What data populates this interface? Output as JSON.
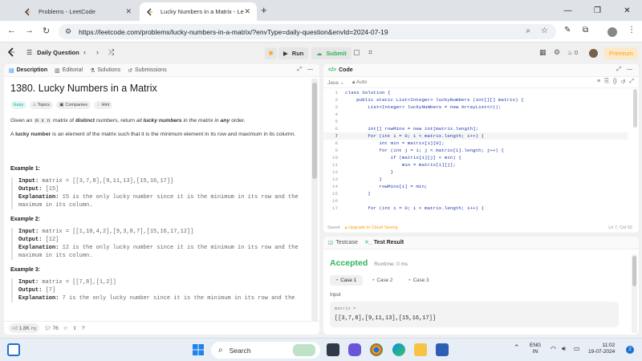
{
  "browser": {
    "tabs": [
      {
        "title": "Problems - LeetCode"
      },
      {
        "title": "Lucky Numbers in a Matrix - Le"
      }
    ],
    "new_tab": "+",
    "url": "https://leetcode.com/problems/lucky-numbers-in-a-matrix/?envType=daily-question&envId=2024-07-19"
  },
  "header": {
    "daily_question": "Daily Question",
    "run": "Run",
    "submit": "Submit",
    "streak": "0",
    "premium": "Premium"
  },
  "left_tabs": [
    "Description",
    "Editorial",
    "Solutions",
    "Submissions"
  ],
  "problem": {
    "title": "1380. Lucky Numbers in a Matrix",
    "chips": [
      "Easy",
      "Topics",
      "Companies",
      "Hint"
    ],
    "intro_1": "Given an",
    "mxn": "m x n",
    "intro_2": "matrix of",
    "distinct": "distinct",
    "intro_3": "numbers, return",
    "all": "all",
    "lucky": "lucky numbers",
    "intro_4": "in the matrix in",
    "any": "any",
    "intro_5": "order.",
    "def_1": "A",
    "def_lucky": "lucky number",
    "def_2": "is an element of the matrix such that it is the minimum element in its row and maximum in its column."
  },
  "examples": [
    {
      "heading": "Example 1:",
      "input_label": "Input:",
      "input": "matrix = [[3,7,8],[9,11,13],[15,16,17]]",
      "output_label": "Output:",
      "output": "[15]",
      "expl_label": "Explanation:",
      "expl_1": "15 is the only lucky number since it is the minimum in its row and the",
      "expl_2": "maximum in its column."
    },
    {
      "heading": "Example 2:",
      "input_label": "Input:",
      "input": "matrix = [[1,10,4,2],[9,3,8,7],[15,16,17,12]]",
      "output_label": "Output:",
      "output": "[12]",
      "expl_label": "Explanation:",
      "expl_1": "12 is the only lucky number since it is the minimum in its row and the",
      "expl_2": "maximum in its column."
    },
    {
      "heading": "Example 3:",
      "input_label": "Input:",
      "input": "matrix = [[7,8],[1,2]]",
      "output_label": "Output:",
      "output": "[7]",
      "expl_label": "Explanation:",
      "expl_1": "7 is the only lucky number since it is the minimum in its row and the"
    }
  ],
  "left_footer": {
    "likes": "1.8K",
    "comments": "76"
  },
  "code_panel": {
    "tab": "Code",
    "lang": "Java",
    "mode": "Auto",
    "lines": [
      "class Solution {",
      "    public static List<Integer> luckyNumbers (int[][] matrix) {",
      "        List<Integer> luckyNumbers = new ArrayList<>();",
      "",
      "",
      "        int[] rowMins = new int[matrix.length];",
      "        for (int i = 0; i < matrix.length; i++) {",
      "            int min = matrix[i][0];",
      "            for (int j = 1; j < matrix[i].length; j++) {",
      "                if (matrix[i][j] < min) {",
      "                    min = matrix[i][j];",
      "                }",
      "            }",
      "            rowMins[i] = min;",
      "        }",
      "",
      "        for (int i = 0; i < matrix.length; i++) {"
    ],
    "line_numbers": [
      "1",
      "2",
      "3",
      "4",
      "5",
      "6",
      "7",
      "8",
      "9",
      "10",
      "11",
      "12",
      "13",
      "14",
      "15",
      "16",
      "17"
    ],
    "saved": "Saved",
    "upgrade": "Upgrade to Cloud Saving",
    "cursor": "Ln 7, Col 52"
  },
  "result_panel": {
    "tabs": [
      "Testcase",
      "Test Result"
    ],
    "status": "Accepted",
    "runtime": "Runtime: 0 ms",
    "cases": [
      "Case 1",
      "Case 2",
      "Case 3"
    ],
    "input_label": "Input",
    "var_name": "matrix =",
    "var_value": "[[3,7,8],[9,11,13],[15,16,17]]"
  },
  "taskbar": {
    "search": "Search",
    "lang_1": "ENG",
    "lang_2": "IN",
    "time": "11:02",
    "date": "19-07-2024",
    "notifications": "2"
  },
  "colors": {
    "accent_orange": "#ffa116",
    "success_green": "#2db55d",
    "easy_teal": "#00af9b"
  }
}
